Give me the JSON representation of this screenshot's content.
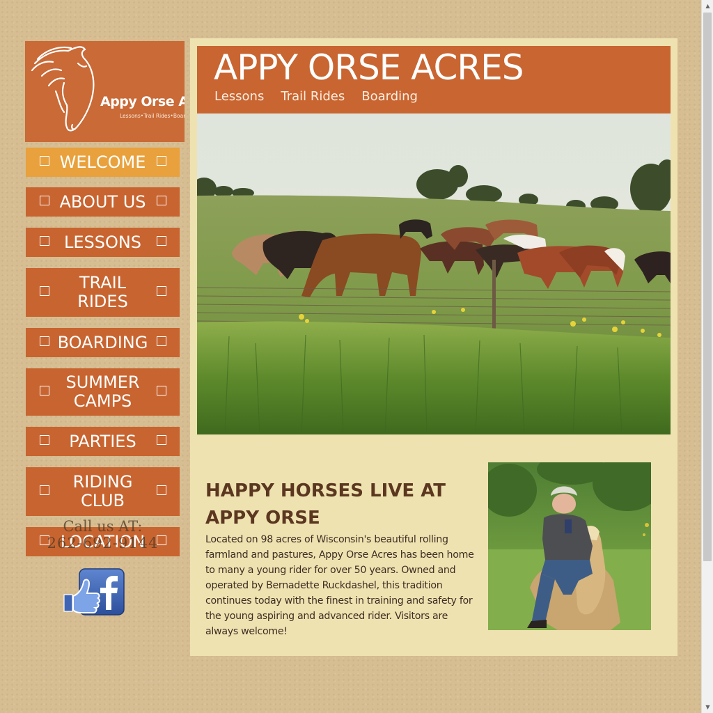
{
  "logo": {
    "title": "Appy Orse Acres",
    "subtitle": "Lessons•Trail Rides•Boarding"
  },
  "nav": {
    "items": [
      {
        "label": "WELCOME",
        "active": true
      },
      {
        "label": "ABOUT US"
      },
      {
        "label": "LESSONS"
      },
      {
        "label": "TRAIL RIDES"
      },
      {
        "label": "BOARDING"
      },
      {
        "label": "SUMMER CAMPS"
      },
      {
        "label": "PARTIES"
      },
      {
        "label": "RIDING CLUB"
      },
      {
        "label": "LOCATION"
      }
    ]
  },
  "contact": {
    "call_label": "Call us AT:",
    "phone": "262-692-9144"
  },
  "header": {
    "site_title": "APPY ORSE ACRES",
    "links": [
      "Lessons",
      "Trail Rides",
      "Boarding"
    ]
  },
  "main": {
    "headline": "HAPPY HORSES LIVE AT APPY ORSE",
    "body": "Located on 98 acres of Wisconsin's beautiful rolling farmland and pastures, Appy Orse Acres has been home to many a young rider for over 50 years. Owned and operated by Bernadette Ruckdashel, this tradition continues today with the finest in training and safety for the young aspiring and advanced rider. Visitors are always welcome!"
  },
  "colors": {
    "nav_bg": "#c8642f",
    "nav_active": "#e8a13c",
    "banner_bg": "#c96531",
    "panel_bg": "#efe2b1",
    "page_bg": "#d7bd92",
    "headline": "#5b3720"
  },
  "icons": {
    "nav_checkbox": "checkbox-outline-icon",
    "facebook": "facebook-like-icon"
  }
}
